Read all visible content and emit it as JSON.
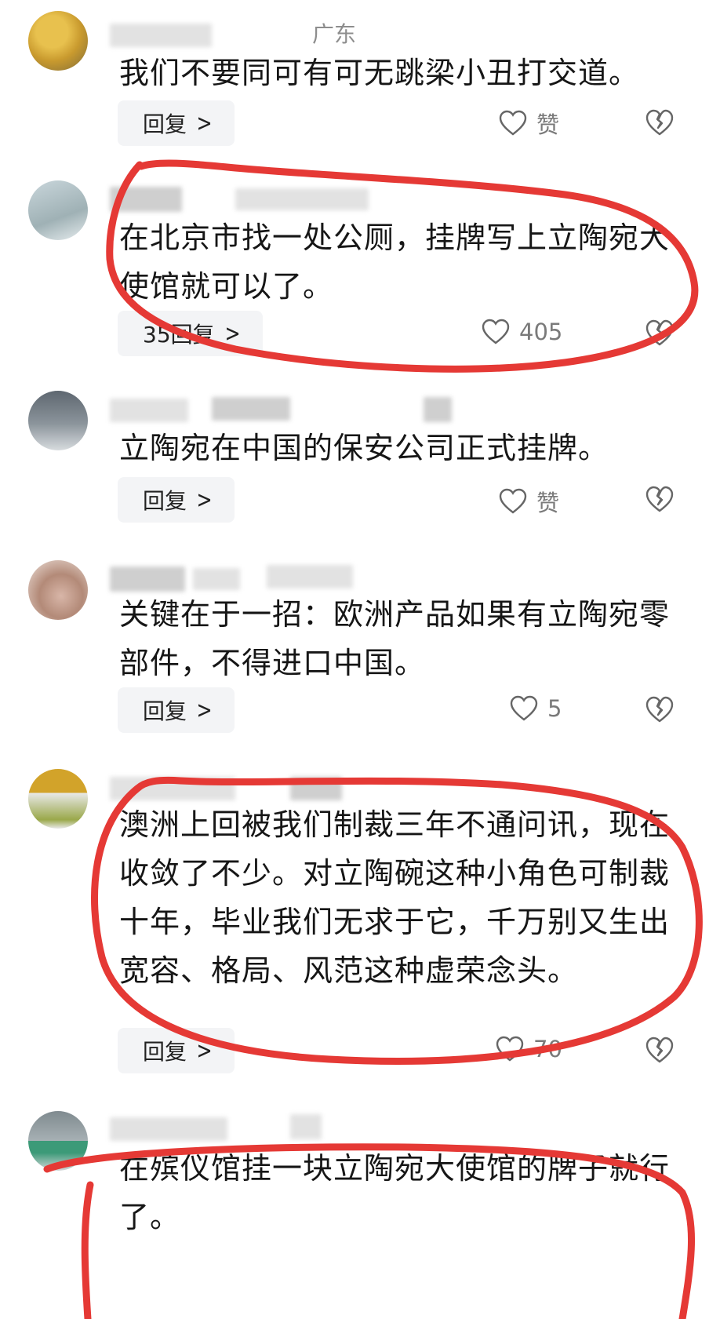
{
  "comments": [
    {
      "location": "广东",
      "text": "我们不要同可有可无跳梁小丑打交道。",
      "reply_label": "回复",
      "like_label": "赞"
    },
    {
      "text": "在北京市找一处公厕，挂牌写上立陶宛大使馆就可以了。",
      "reply_label": "35回复",
      "like_label": "405"
    },
    {
      "text": "立陶宛在中国的保安公司正式挂牌。",
      "reply_label": "回复",
      "like_label": "赞"
    },
    {
      "text": "关键在于一招：欧洲产品如果有立陶宛零部件，不得进口中国。",
      "reply_label": "回复",
      "like_label": "5"
    },
    {
      "text": "澳洲上回被我们制裁三年不通问讯，现在收敛了不少。对立陶碗这种小角色可制裁十年，毕业我们无求于它，千万别又生出宽容、格局、风范这种虚荣念头。",
      "reply_label": "回复",
      "like_label": "70"
    },
    {
      "text": "在殡仪馆挂一块立陶宛大使馆的牌子就行了。"
    }
  ],
  "colors": {
    "annotation": "#e53935",
    "reply_bg": "#f3f4f6",
    "muted": "#8d8d8d"
  },
  "icons": {
    "like": "heart-outline-icon",
    "dislike": "broken-heart-icon",
    "reply": "chevron-right-icon"
  }
}
